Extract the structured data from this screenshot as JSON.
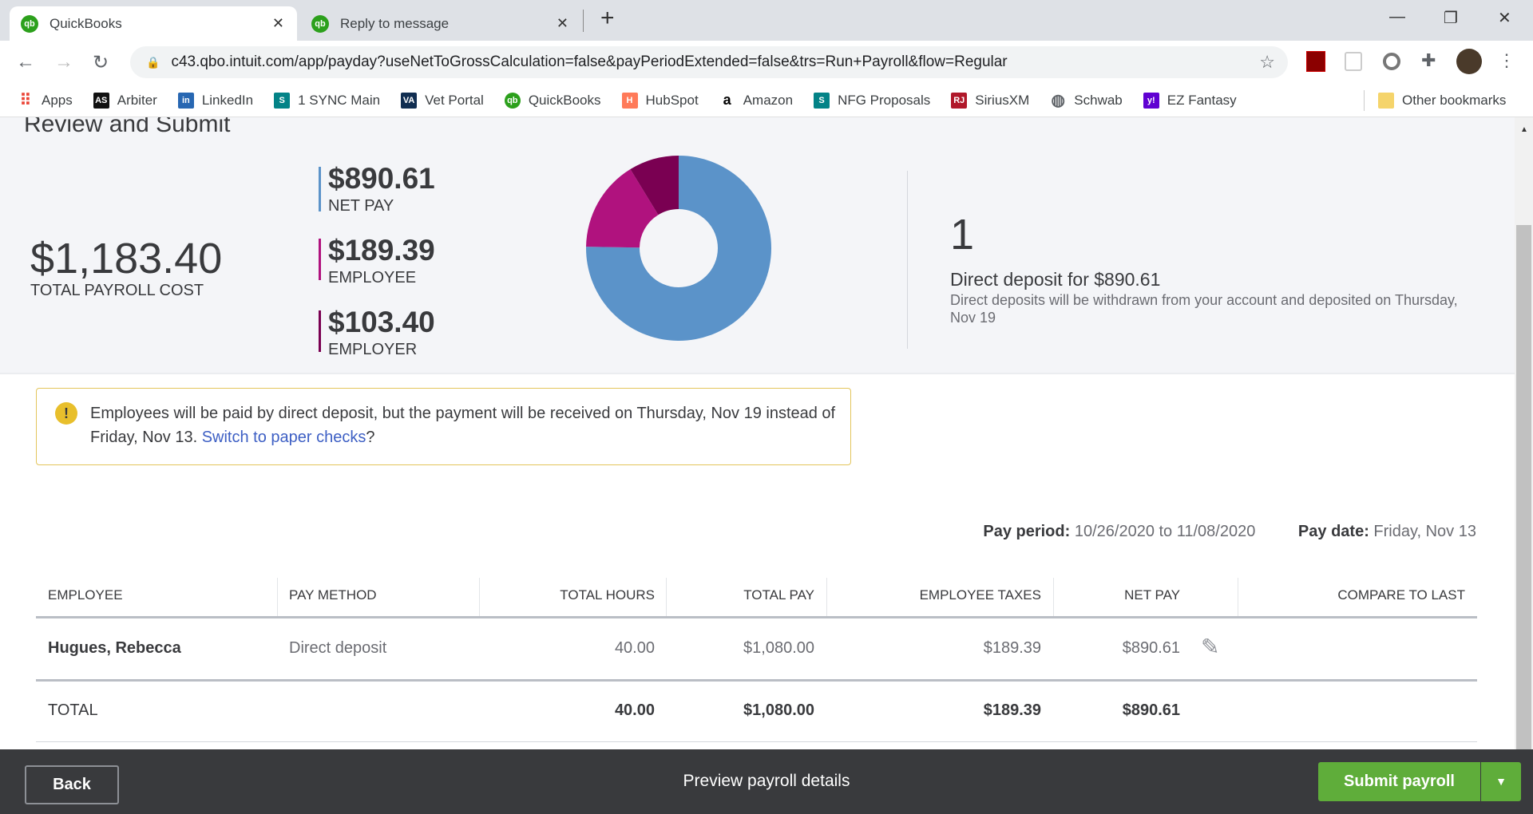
{
  "browser": {
    "tabs": [
      {
        "label": "QuickBooks",
        "active": true
      },
      {
        "label": "Reply to message",
        "active": false
      }
    ],
    "new_tab": "+",
    "url": "c43.qbo.intuit.com/app/payday?useNetToGrossCalculation=false&payPeriodExtended=false&trs=Run+Payroll&flow=Regular",
    "bookmarks": [
      {
        "label": "Apps",
        "icon": "apps-grid-icon",
        "color": "#ea4335"
      },
      {
        "label": "Arbiter",
        "icon": "AS",
        "color": "#111111"
      },
      {
        "label": "LinkedIn",
        "icon": "in",
        "color": "#2867b2"
      },
      {
        "label": "1 SYNC Main",
        "icon": "S",
        "color": "#038387"
      },
      {
        "label": "Vet Portal",
        "icon": "VA",
        "color": "#112e51"
      },
      {
        "label": "QuickBooks",
        "icon": "qb",
        "color": "#2ca01c"
      },
      {
        "label": "HubSpot",
        "icon": "H",
        "color": "#ff7a59"
      },
      {
        "label": "Amazon",
        "icon": "a",
        "color": "#000000"
      },
      {
        "label": "NFG Proposals",
        "icon": "S",
        "color": "#038387"
      },
      {
        "label": "SiriusXM",
        "icon": "RJ",
        "color": "#b0182a"
      },
      {
        "label": "Schwab",
        "icon": "globe-icon",
        "color": "#5f6368"
      },
      {
        "label": "EZ Fantasy",
        "icon": "y!",
        "color": "#6001d2"
      }
    ],
    "other_bookmarks": "Other bookmarks"
  },
  "page": {
    "title": "Review and Submit",
    "total_cost": {
      "value": "$1,183.40",
      "label": "TOTAL PAYROLL COST"
    },
    "breakdown": [
      {
        "value": "$890.61",
        "label": "NET PAY",
        "color": "#5b93c9"
      },
      {
        "value": "$189.39",
        "label": "EMPLOYEE",
        "color": "#b0127e"
      },
      {
        "value": "$103.40",
        "label": "EMPLOYER",
        "color": "#7a0052"
      }
    ],
    "donut": {
      "type": "pie",
      "values": [
        890.61,
        189.39,
        103.4
      ],
      "colors": [
        "#5b93c9",
        "#b0127e",
        "#7a0052"
      ]
    },
    "deposit": {
      "count": "1",
      "title": "Direct deposit for $890.61",
      "desc": "Direct deposits will be withdrawn from your account and deposited on Thursday, Nov 19"
    },
    "warning": {
      "text": "Employees will be paid by direct deposit, but the payment will be received on Thursday, Nov 19 instead of Friday, Nov 13. ",
      "link": "Switch to paper checks",
      "end": "?"
    },
    "pay_period": {
      "label": "Pay period:",
      "value": "10/26/2020 to 11/08/2020"
    },
    "pay_date": {
      "label": "Pay date:",
      "value": "Friday, Nov 13"
    },
    "table": {
      "headers": [
        "EMPLOYEE",
        "PAY METHOD",
        "TOTAL HOURS",
        "TOTAL PAY",
        "EMPLOYEE TAXES",
        "NET PAY",
        "COMPARE TO LAST"
      ],
      "row": [
        "Hugues, Rebecca",
        "Direct deposit",
        "40.00",
        "$1,080.00",
        "$189.39",
        "$890.61"
      ],
      "total": [
        "TOTAL",
        "40.00",
        "$1,080.00",
        "$189.39",
        "$890.61"
      ]
    }
  },
  "footer": {
    "back": "Back",
    "preview": "Preview payroll details",
    "submit": "Submit payroll"
  }
}
